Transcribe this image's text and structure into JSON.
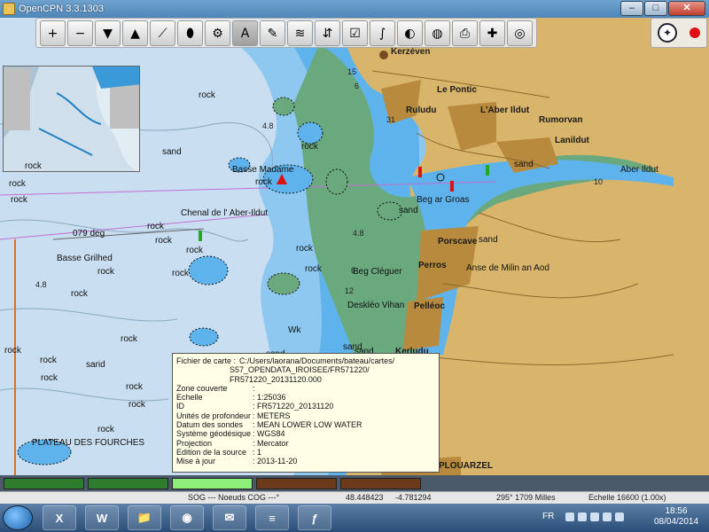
{
  "window": {
    "title": "OpenCPN 3.3.1303"
  },
  "toolbar": {
    "buttons": [
      {
        "name": "zoom-in",
        "glyph": "+"
      },
      {
        "name": "zoom-out",
        "glyph": "−"
      },
      {
        "name": "chart-scale-down",
        "glyph": "▼"
      },
      {
        "name": "chart-scale-up",
        "glyph": "▲"
      },
      {
        "name": "route",
        "glyph": "⟋"
      },
      {
        "name": "follow-ship",
        "glyph": "⬮"
      },
      {
        "name": "settings",
        "glyph": "⚙"
      },
      {
        "name": "text",
        "glyph": "A"
      },
      {
        "name": "current",
        "glyph": "✎"
      },
      {
        "name": "tides",
        "glyph": "≋"
      },
      {
        "name": "currents",
        "glyph": "⇵"
      },
      {
        "name": "route-manager",
        "glyph": "☑"
      },
      {
        "name": "track",
        "glyph": "∫"
      },
      {
        "name": "color-scheme",
        "glyph": "◐"
      },
      {
        "name": "ais",
        "glyph": "◍"
      },
      {
        "name": "print",
        "glyph": "⎙"
      },
      {
        "name": "mob",
        "glyph": "✚"
      },
      {
        "name": "help",
        "glyph": "◎"
      }
    ]
  },
  "map": {
    "labels": [
      {
        "text": "Kerzéven",
        "cls": "place"
      },
      {
        "text": "Le Pontic",
        "cls": "town"
      },
      {
        "text": "Ruludu",
        "cls": "town"
      },
      {
        "text": "L'Aber Ildut",
        "cls": "town"
      },
      {
        "text": "Rumorvan",
        "cls": "town"
      },
      {
        "text": "Lanildut",
        "cls": "town"
      },
      {
        "text": "Aber Ildut",
        "cls": ""
      },
      {
        "text": "Basse Madame",
        "cls": ""
      },
      {
        "text": "Chenal de l' Aber-Ildut",
        "cls": ""
      },
      {
        "text": "079 deg",
        "cls": ""
      },
      {
        "text": "Basse Grilhed",
        "cls": ""
      },
      {
        "text": "Beg ar Groas",
        "cls": ""
      },
      {
        "text": "Porscave",
        "cls": "town"
      },
      {
        "text": "Perros",
        "cls": "town"
      },
      {
        "text": "Anse de Milin an Aod",
        "cls": ""
      },
      {
        "text": "Beg Cléguer",
        "cls": ""
      },
      {
        "text": "Pelléoc",
        "cls": "town"
      },
      {
        "text": "Kerludu",
        "cls": "town"
      },
      {
        "text": "PLATEAU DES FOURCHES",
        "cls": ""
      },
      {
        "text": "PLOUARZEL",
        "cls": "town"
      },
      {
        "text": "sand",
        "cls": ""
      },
      {
        "text": "sand",
        "cls": ""
      },
      {
        "text": "sand",
        "cls": ""
      },
      {
        "text": "sand",
        "cls": ""
      },
      {
        "text": "sand",
        "cls": ""
      },
      {
        "text": "sand",
        "cls": ""
      },
      {
        "text": "sand",
        "cls": ""
      },
      {
        "text": "sand",
        "cls": ""
      },
      {
        "text": "sarid",
        "cls": ""
      },
      {
        "text": "rock",
        "cls": ""
      },
      {
        "text": "rock",
        "cls": ""
      },
      {
        "text": "rock",
        "cls": ""
      },
      {
        "text": "rock",
        "cls": ""
      },
      {
        "text": "rock",
        "cls": ""
      },
      {
        "text": "rock",
        "cls": ""
      },
      {
        "text": "rock",
        "cls": ""
      },
      {
        "text": "rock",
        "cls": ""
      },
      {
        "text": "rock",
        "cls": ""
      },
      {
        "text": "rock",
        "cls": ""
      },
      {
        "text": "rock",
        "cls": ""
      },
      {
        "text": "rock",
        "cls": ""
      },
      {
        "text": "rock",
        "cls": ""
      },
      {
        "text": "rock",
        "cls": ""
      },
      {
        "text": "rock",
        "cls": ""
      },
      {
        "text": "rock",
        "cls": ""
      },
      {
        "text": "rock",
        "cls": ""
      },
      {
        "text": "rock",
        "cls": ""
      },
      {
        "text": "rock",
        "cls": ""
      },
      {
        "text": "rock",
        "cls": ""
      },
      {
        "text": "rock",
        "cls": ""
      },
      {
        "text": "Wk",
        "cls": ""
      },
      {
        "text": "4.8",
        "cls": "depth"
      },
      {
        "text": "4.8",
        "cls": "depth"
      },
      {
        "text": "4.8",
        "cls": "depth"
      },
      {
        "text": "12",
        "cls": "depth"
      },
      {
        "text": "15",
        "cls": "depth"
      },
      {
        "text": "6",
        "cls": "depth"
      },
      {
        "text": "31",
        "cls": "depth"
      },
      {
        "text": "10",
        "cls": "depth"
      },
      {
        "text": "6",
        "cls": "depth"
      },
      {
        "text": "Deskléo Vihan",
        "cls": ""
      }
    ]
  },
  "popup": {
    "file_label": "Fichier de carte :",
    "file_value_1": "C:/Users/laorana/Documents/bateau/cartes/",
    "file_value_2": "S57_OPENDATA_IROISEE/FR571220/",
    "file_value_3": "FR571220_20131120.000",
    "rows": [
      {
        "k": "Zone couverte",
        "v": ":"
      },
      {
        "k": "Echelle",
        "v": ": 1:25036"
      },
      {
        "k": "ID",
        "v": ": FR571220_20131120"
      },
      {
        "k": "Unités de profondeur",
        "v": ": METERS"
      },
      {
        "k": "Datum des sondes",
        "v": ": MEAN LOWER LOW WATER"
      },
      {
        "k": "Système géodésique",
        "v": ": WGS84"
      },
      {
        "k": "Projection",
        "v": ": Mercator"
      },
      {
        "k": "Edition de la source",
        "v": ": 1"
      },
      {
        "k": "Mise à jour",
        "v": ": 2013-11-20"
      }
    ]
  },
  "chartbar": {
    "chips": [
      {
        "color": "#2e7d2e"
      },
      {
        "color": "#2e7d2e"
      },
      {
        "color": "#8ef07a"
      },
      {
        "color": "#6b3a1a"
      },
      {
        "color": "#6b3a1a"
      }
    ]
  },
  "status": {
    "sog": "SOG --- Noeuds COG ---°",
    "lat": "48.448423",
    "lon": "-4.781294",
    "bearing": "295° 1709 Milles",
    "scale": "Echelle 16600 (1.00x)"
  },
  "taskbar": {
    "apps": [
      "X",
      "W",
      "📁",
      "◉",
      "✉",
      "≡",
      "ƒ"
    ],
    "lang": "FR",
    "time": "18:56",
    "date": "08/04/2014"
  },
  "colors": {
    "sea_light": "#c9def0",
    "sea_shallow": "#5fb3ec",
    "land": "#d8b56a",
    "intertidal": "#6aa87e",
    "urban": "#b78a3e"
  }
}
